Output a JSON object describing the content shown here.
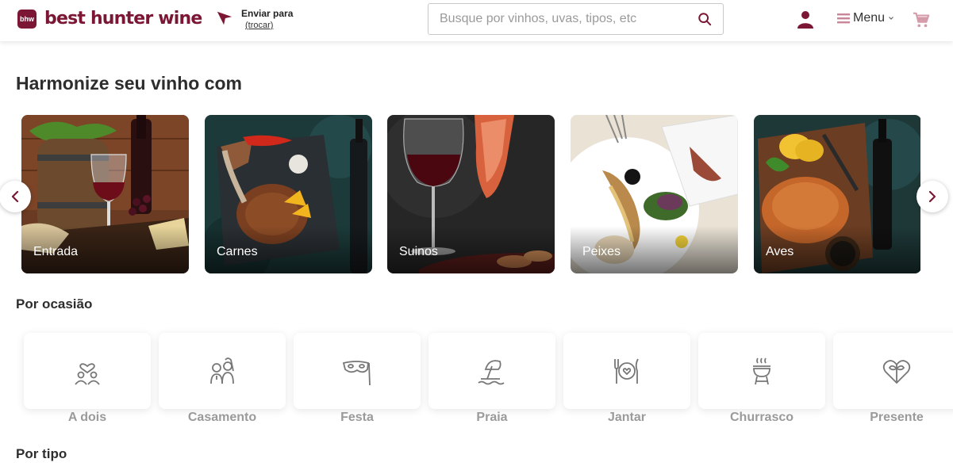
{
  "header": {
    "logo_badge": "bhw",
    "logo_text": "best hunter wine",
    "ship_label": "Enviar para",
    "ship_link": "(trocar)",
    "search_placeholder": "Busque por vinhos, uvas, tipos, etc",
    "menu_label": "Menu",
    "brand_color": "#7b1734"
  },
  "pairing": {
    "title": "Harmonize seu vinho com",
    "items": [
      {
        "label": "Entrada",
        "icon": "appetizer-wine-image"
      },
      {
        "label": "Carnes",
        "icon": "steak-image"
      },
      {
        "label": "Suinos",
        "icon": "pork-wine-image"
      },
      {
        "label": "Peixes",
        "icon": "fish-plate-image"
      },
      {
        "label": "Aves",
        "icon": "roast-chicken-image"
      }
    ]
  },
  "occasions": {
    "title": "Por ocasião",
    "items": [
      {
        "label": "A dois",
        "icon": "couple-heart-icon"
      },
      {
        "label": "Casamento",
        "icon": "bride-groom-icon"
      },
      {
        "label": "Festa",
        "icon": "party-mask-icon"
      },
      {
        "label": "Praia",
        "icon": "beach-umbrella-icon"
      },
      {
        "label": "Jantar",
        "icon": "dinner-plate-icon"
      },
      {
        "label": "Churrasco",
        "icon": "grill-icon"
      },
      {
        "label": "Presente",
        "icon": "gift-heart-icon"
      }
    ]
  },
  "by_type": {
    "title": "Por tipo"
  }
}
